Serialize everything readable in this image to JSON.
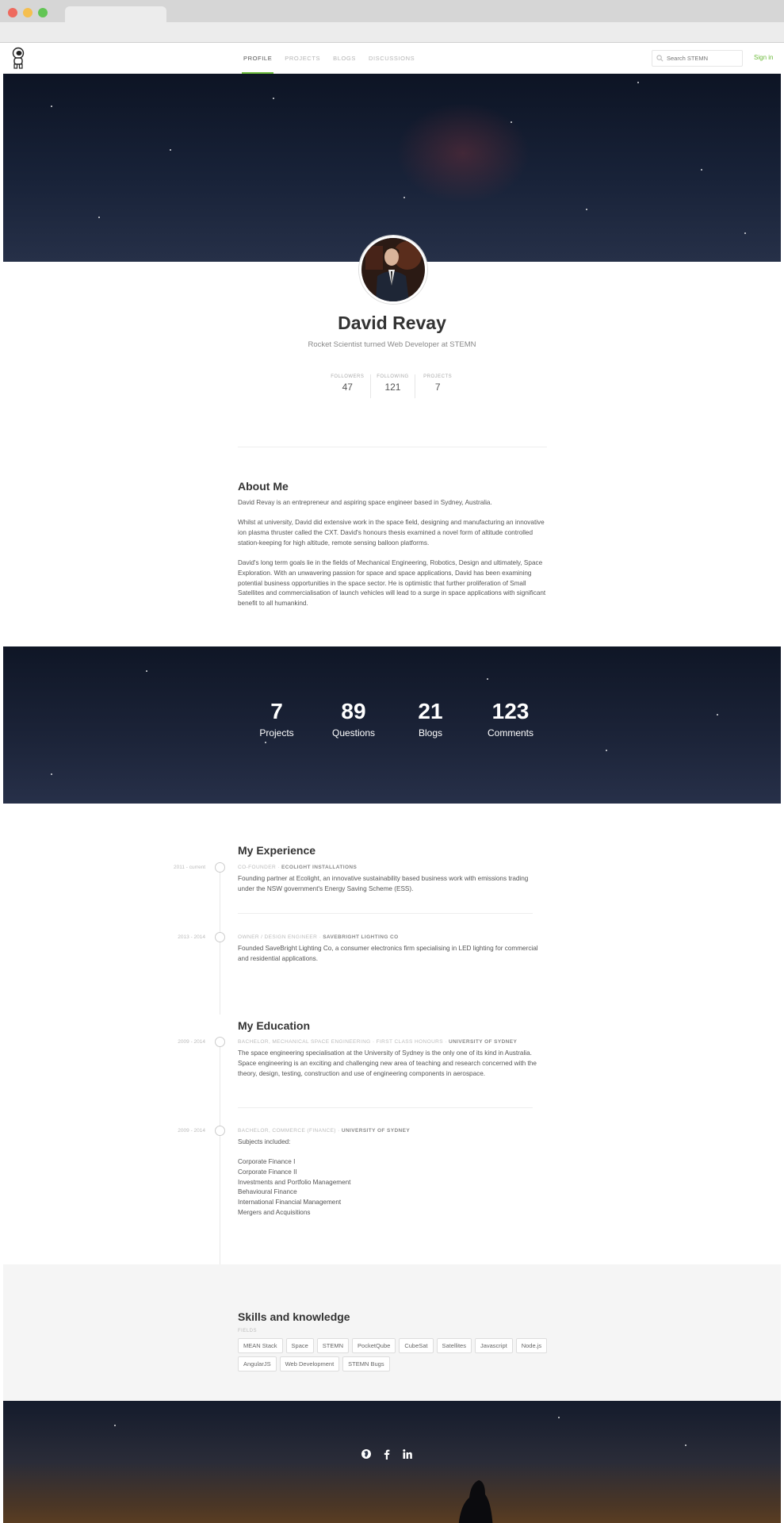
{
  "nav": {
    "links": [
      "PROFILE",
      "PROJECTS",
      "BLOGS",
      "DISCUSSIONS"
    ],
    "search_placeholder": "Search STEMN",
    "signin": "Sign in"
  },
  "profile": {
    "name": "David Revay",
    "tagline": "Rocket Scientist turned Web Developer at STEMN",
    "counts": [
      {
        "label": "FOLLOWERS",
        "value": "47"
      },
      {
        "label": "FOLLOWING",
        "value": "121"
      },
      {
        "label": "PROJECTS",
        "value": "7"
      }
    ]
  },
  "about": {
    "title": "About Me",
    "paragraphs": [
      "David Revay is an entrepreneur and aspiring space engineer based in Sydney, Australia.",
      "Whilst at university, David did extensive work in the space field, designing and manufacturing an innovative ion plasma thruster called the CXT. David's honours thesis examined a novel form of altitude controlled station-keeping for high altitude, remote sensing balloon platforms.",
      "David's long term goals lie in the fields of Mechanical Engineering, Robotics, Design and ultimately, Space Exploration. With an unwavering passion for space and space applications, David has been examining potential business opportunities in the space sector. He is optimistic that further proliferation of Small Satellites and commercialisation of launch vehicles will lead to a surge in space applications with significant benefit to all humankind."
    ]
  },
  "stats": [
    {
      "value": "7",
      "label": "Projects"
    },
    {
      "value": "89",
      "label": "Questions"
    },
    {
      "value": "21",
      "label": "Blogs"
    },
    {
      "value": "123",
      "label": "Comments"
    }
  ],
  "experience": {
    "title": "My Experience",
    "items": [
      {
        "date": "2011 - current",
        "role": "CO-FOUNDER · ",
        "org": "ECOLIGHT INSTALLATIONS",
        "desc": "Founding partner at Ecolight, an innovative sustainability based business work with emissions trading under the NSW government's Energy Saving Scheme (ESS)."
      },
      {
        "date": "2013 - 2014",
        "role": "OWNER / DESIGN ENGINEER · ",
        "org": "SAVEBRIGHT LIGHTING CO",
        "desc": "Founded SaveBright Lighting Co, a consumer electronics firm specialising in LED lighting for commercial and residential applications."
      }
    ]
  },
  "education": {
    "title": "My Education",
    "items": [
      {
        "date": "2009 - 2014",
        "role": "BACHELOR, MECHANICAL SPACE ENGINEERING · FIRST CLASS HONOURS · ",
        "org": "UNIVERSITY OF SYDNEY",
        "desc": "The space engineering specialisation at the University of Sydney is the only one of its kind in Australia. Space engineering is an exciting and challenging new area of teaching and research concerned with the theory, design, testing, construction and use of engineering components in aerospace."
      },
      {
        "date": "2009 - 2014",
        "role": "BACHELOR, COMMERCE (FINANCE) · ",
        "org": "UNIVERSITY OF SYDNEY",
        "intro": "Subjects included:",
        "subjects": [
          "Corporate Finance I",
          "Corporate Finance II",
          "Investments and Portfolio Management",
          "Behavioural Finance",
          "International Financial Management",
          "Mergers and Acquisitions"
        ]
      }
    ]
  },
  "skills": {
    "title": "Skills and knowledge",
    "fields_label": "FIELDS",
    "row1": [
      "MEAN Stack",
      "Space",
      "STEMN",
      "PocketQube",
      "CubeSat",
      "Satellites",
      "Javascript",
      "Node.js"
    ],
    "row2": [
      "AngularJS",
      "Web Development",
      "STEMN Bugs"
    ]
  },
  "colors": {
    "accent": "#6dbb3c",
    "night": "#182238"
  },
  "icons": [
    "search-icon",
    "globe-icon",
    "facebook-icon",
    "linkedin-icon"
  ]
}
